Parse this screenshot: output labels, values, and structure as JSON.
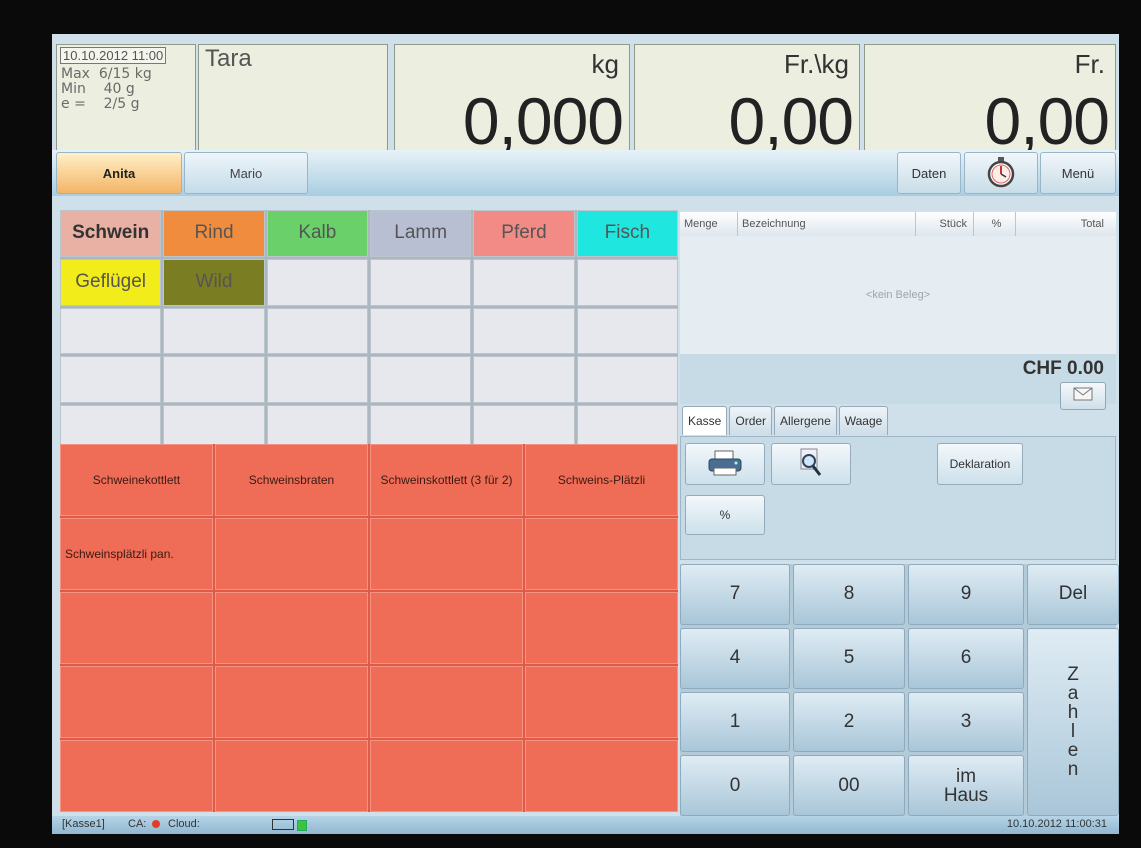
{
  "display": {
    "datetime": "10.10.2012 11:00",
    "info_lines": "Max  6/15 kg\nMin    40 g\ne =    2/5 g",
    "tara_label": "Tara",
    "weight_unit": "kg",
    "weight_value": "0,000",
    "price_unit": "Fr.\\kg",
    "price_value": "0,00",
    "total_unit": "Fr.",
    "total_value": "0,00"
  },
  "users": {
    "anita": "Anita",
    "mario": "Mario"
  },
  "toolbar": {
    "daten": "Daten",
    "timer_icon": "stopwatch-icon",
    "menu": "Menü"
  },
  "categories": [
    {
      "label": "Schwein",
      "color": "#e9b0a4"
    },
    {
      "label": "Rind",
      "color": "#f08c3e"
    },
    {
      "label": "Kalb",
      "color": "#69d06a"
    },
    {
      "label": "Lamm",
      "color": "#b9bfd3"
    },
    {
      "label": "Pferd",
      "color": "#f28b86"
    },
    {
      "label": "Fisch",
      "color": "#20e6e0"
    },
    {
      "label": "Geflügel",
      "color": "#f2ec1a"
    },
    {
      "label": "Wild",
      "color": "#7a7d22"
    }
  ],
  "products": [
    "Schweinekottlett",
    "Schweinsbraten",
    "Schweinskottlett (3 für 2)",
    "Schweins-Plätzli",
    "Schweinsplätzli pan."
  ],
  "receipt": {
    "columns": [
      "Menge",
      "Bezeichnung",
      "Stück",
      "%",
      "Total"
    ],
    "empty": "<kein Beleg>",
    "total": "CHF 0.00",
    "mail_icon": "envelope-icon"
  },
  "tabs": [
    "Kasse",
    "Order",
    "Allergene",
    "Waage"
  ],
  "functions": {
    "printer_icon": "printer-icon",
    "search_icon": "search-icon",
    "deklaration": "Deklaration",
    "percent": "%"
  },
  "keypad": {
    "k7": "7",
    "k8": "8",
    "k9": "9",
    "del": "Del",
    "k4": "4",
    "k5": "5",
    "k6": "6",
    "k1": "1",
    "k2": "2",
    "k3": "3",
    "k0": "0",
    "k00": "00",
    "imhaus_1": "im",
    "imhaus_2": "Haus",
    "zahlen": [
      "Z",
      "a",
      "h",
      "l",
      "e",
      "n"
    ]
  },
  "status": {
    "kasse": "[Kasse1]",
    "ca": "CA:",
    "cloud": "Cloud:",
    "datetime": "10.10.2012 11:00:31"
  }
}
